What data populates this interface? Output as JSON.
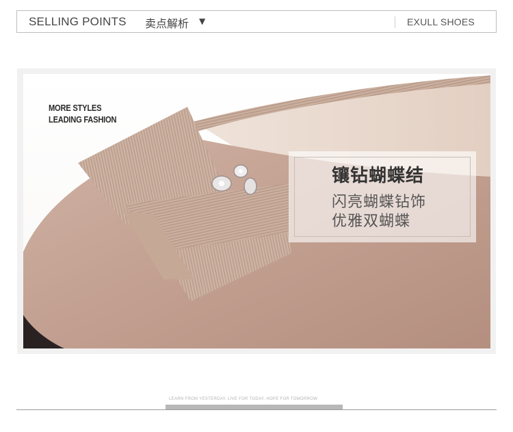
{
  "header": {
    "title_en": "SELLING POINTS",
    "title_cn": "卖点解析",
    "dropdown_glyph": "▼",
    "brand": "EXULL SHOES"
  },
  "photo": {
    "tagline_line1": "MORE STYLES",
    "tagline_line2": "LEADING FASHION",
    "callout": {
      "heading": "镶钻蝴蝶结",
      "line1": "闪亮蝴蝶钻饰",
      "line2": "优雅双蝴蝶"
    }
  },
  "footer": {
    "motto": "LEARN FROM YESTERDAY, LIVE FOR TODAY, HOPE FOR TOMORROW"
  },
  "colors": {
    "suede": "#c4a596",
    "bow": "#c9ad9c",
    "lining": "#e8d8cc",
    "frame": "#f1f1f1"
  }
}
